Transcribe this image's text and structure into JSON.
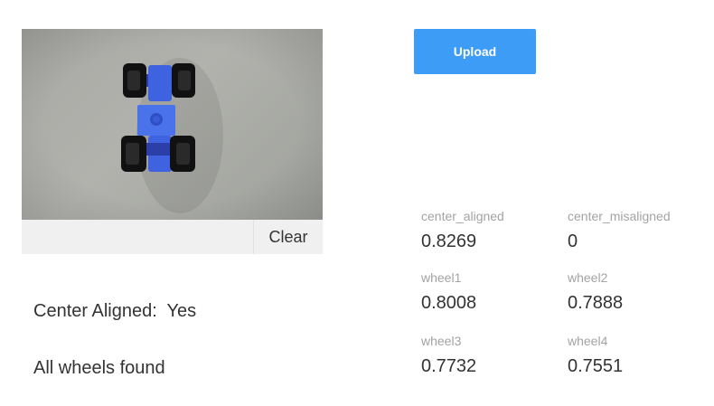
{
  "image_panel": {
    "clear_label": "Clear"
  },
  "results": {
    "center_aligned_label": "Center Aligned:",
    "center_aligned_value": "Yes",
    "wheels_status": "All wheels found"
  },
  "upload": {
    "label": "Upload"
  },
  "metrics": [
    {
      "label": "center_aligned",
      "value": "0.8269"
    },
    {
      "label": "center_misaligned",
      "value": "0"
    },
    {
      "label": "wheel1",
      "value": "0.8008"
    },
    {
      "label": "wheel2",
      "value": "0.7888"
    },
    {
      "label": "wheel3",
      "value": "0.7732"
    },
    {
      "label": "wheel4",
      "value": "0.7551"
    }
  ],
  "colors": {
    "accent": "#3d9cf5",
    "car_body": "#3f63e0",
    "wheel": "#111111"
  }
}
